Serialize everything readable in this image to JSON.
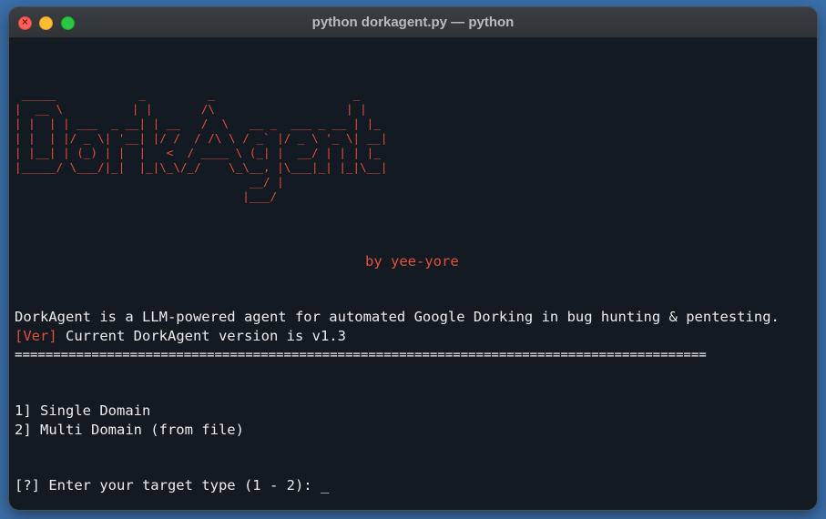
{
  "window": {
    "title": "python dorkagent.py — python"
  },
  "terminal": {
    "banner": [
      " _____            _         _                    _",
      "|  __ \\          | |       /\\                   | |",
      "| |  | | ___  _ __| | __   /  \\   __ _  ___ _ __ | |_",
      "| |  | |/ _ \\| '__| |/ /  / /\\ \\ / _` |/ _ \\ '_ \\| __|",
      "| |__| | (_) | |  |   <  / ____ \\ (_| |  __/ | | | |_",
      "|_____/ \\___/|_|  |_|\\_\\/_/    \\_\\__, |\\___|_| |_|\\__|",
      "                                  __/ |",
      "                                 |___/"
    ],
    "byline": "by yee-yore",
    "description": "DorkAgent is a LLM-powered agent for automated Google Dorking in bug hunting & pentesting.",
    "version_tag": "[Ver]",
    "version_text": " Current DorkAgent version is v1.3",
    "separator": "==========================================================================================",
    "options": [
      "1] Single Domain",
      "2] Multi Domain (from file)"
    ],
    "prompt": "[?] Enter your target type (1 - 2): ",
    "cursor": "_"
  },
  "colors": {
    "accent_red": "#e0503c",
    "background": "#141a22",
    "text": "#ececec"
  }
}
